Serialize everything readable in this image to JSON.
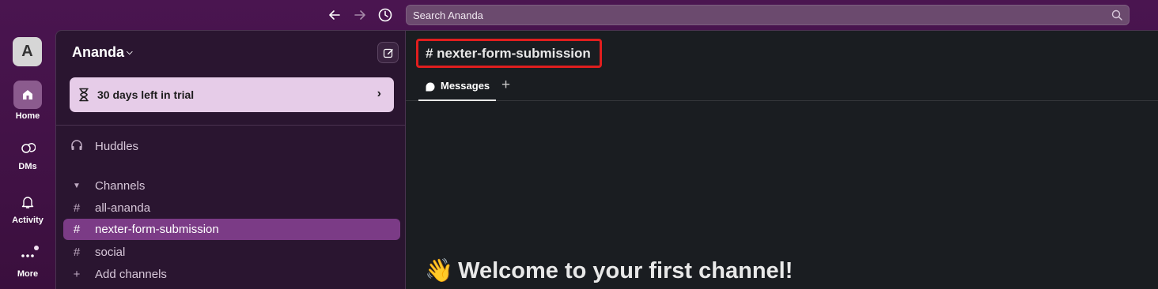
{
  "topbar": {
    "back_icon": "arrow-left-icon",
    "forward_icon": "arrow-right-icon",
    "history_icon": "clock-icon",
    "search_placeholder": "Search Ananda"
  },
  "rail": {
    "workspace_initial": "A",
    "items": [
      {
        "label": "Home",
        "icon": "home-icon"
      },
      {
        "label": "DMs",
        "icon": "dms-icon"
      },
      {
        "label": "Activity",
        "icon": "bell-icon"
      },
      {
        "label": "More",
        "icon": "ellipsis-icon"
      }
    ]
  },
  "sidebar": {
    "workspace_name": "Ananda",
    "trial_text": "30 days left in trial",
    "huddles_label": "Huddles",
    "channels_header": "Channels",
    "channels": [
      {
        "name": "all-ananda"
      },
      {
        "name": "nexter-form-submission",
        "active": true
      },
      {
        "name": "social"
      }
    ],
    "add_channels_label": "Add channels"
  },
  "main": {
    "channel_title": "# nexter-form-submission",
    "tab_messages": "Messages",
    "welcome_text": "Welcome to your first channel!",
    "welcome_emoji": "👋"
  },
  "colors": {
    "aubergine": "#3f0e40",
    "active_channel": "#7b3b86",
    "trial_bg": "#e6cce8",
    "highlight_border": "#e01e1e"
  }
}
